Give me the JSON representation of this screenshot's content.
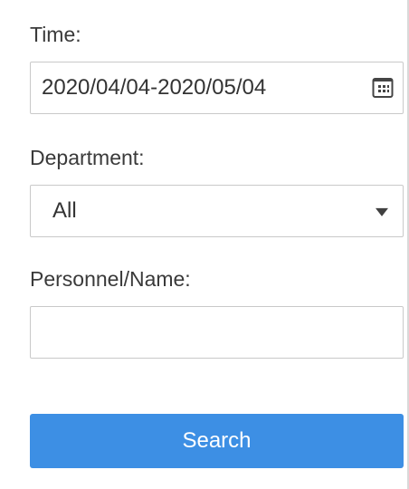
{
  "time": {
    "label": "Time:",
    "value": "2020/04/04-2020/05/04",
    "icon": "calendar-icon"
  },
  "department": {
    "label": "Department:",
    "selected": "All",
    "icon": "dropdown-caret-icon"
  },
  "personnel": {
    "label": "Personnel/Name:",
    "value": ""
  },
  "search": {
    "label": "Search",
    "color": "#3d8fe4"
  }
}
